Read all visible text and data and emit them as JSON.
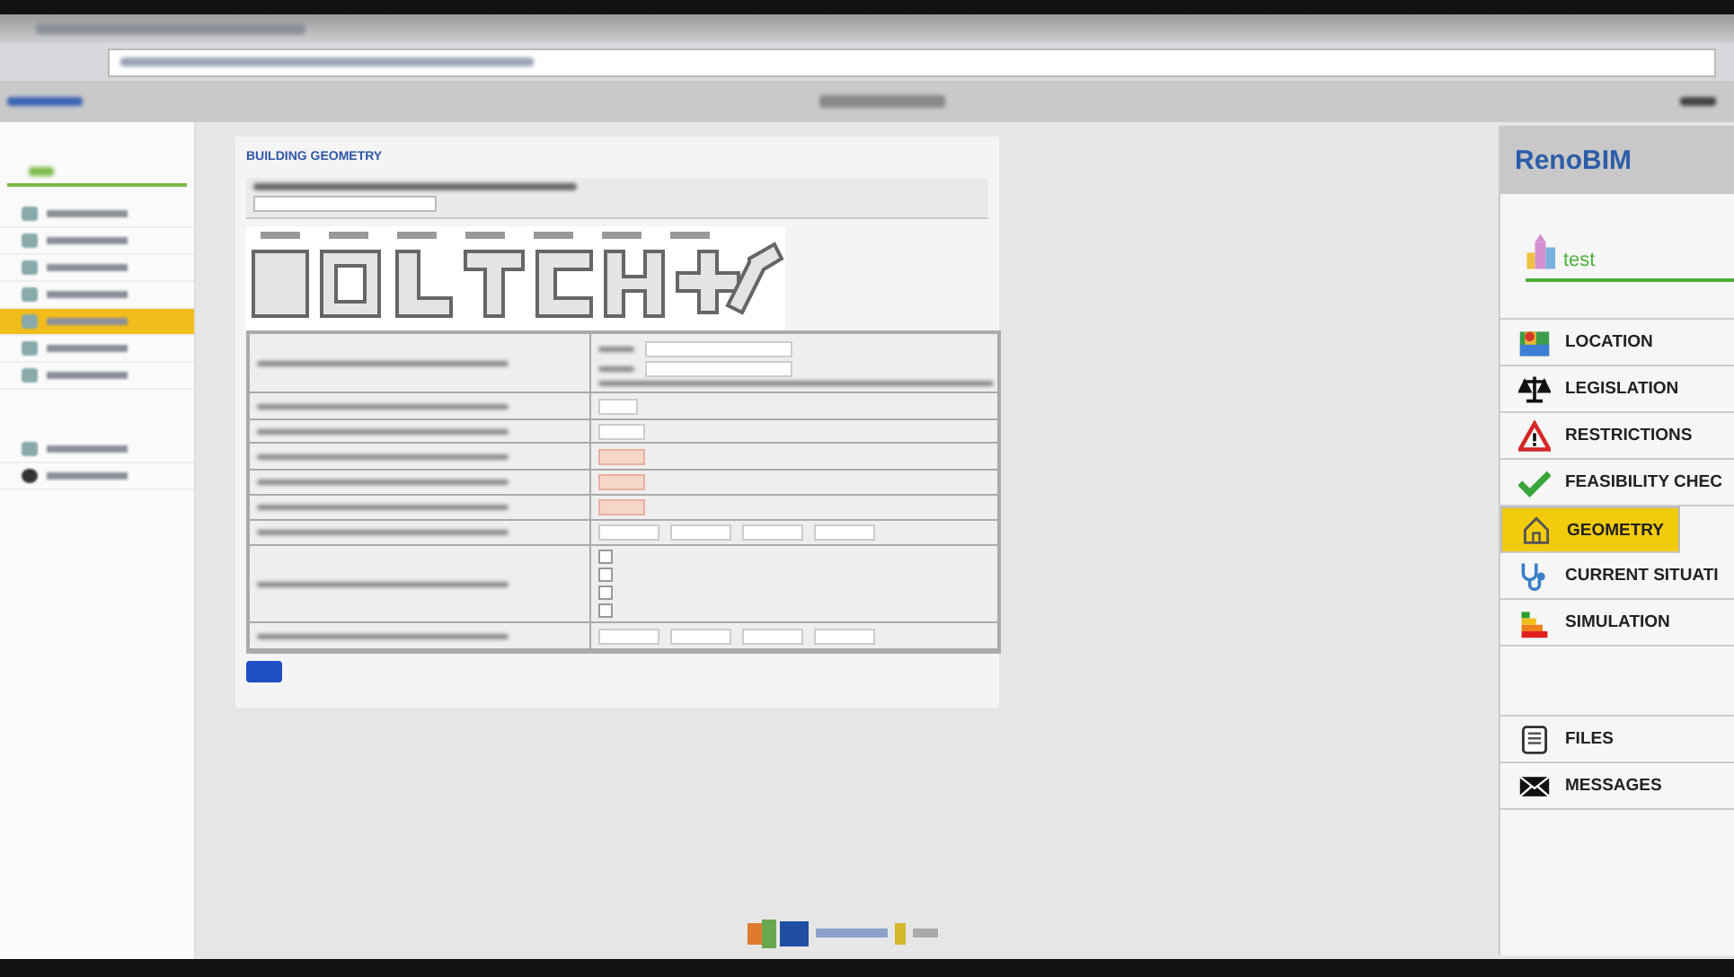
{
  "sidebar": {
    "items": [
      {
        "selected": false
      },
      {
        "selected": false
      },
      {
        "selected": false
      },
      {
        "selected": false
      },
      {
        "selected": true
      },
      {
        "selected": false
      },
      {
        "selected": false
      },
      {
        "selected": false
      },
      {
        "selected": false
      }
    ]
  },
  "page": {
    "heading": "BUILDING GEOMETRY",
    "checkboxes": [
      {
        "checked": false
      },
      {
        "checked": false
      },
      {
        "checked": false
      },
      {
        "checked": false
      }
    ]
  },
  "overlay": {
    "title": "RenoBIM",
    "project": "test",
    "menu": [
      {
        "label": "LOCATION",
        "selected": false
      },
      {
        "label": "LEGISLATION",
        "selected": false
      },
      {
        "label": "RESTRICTIONS",
        "selected": false
      },
      {
        "label": "FEASIBILITY CHEC",
        "selected": false
      },
      {
        "label": "GEOMETRY",
        "selected": true
      },
      {
        "label": "CURRENT SITUATI",
        "selected": false
      },
      {
        "label": "SIMULATION",
        "selected": false
      }
    ],
    "bottom_menu": [
      {
        "label": "FILES"
      },
      {
        "label": "MESSAGES"
      }
    ]
  }
}
